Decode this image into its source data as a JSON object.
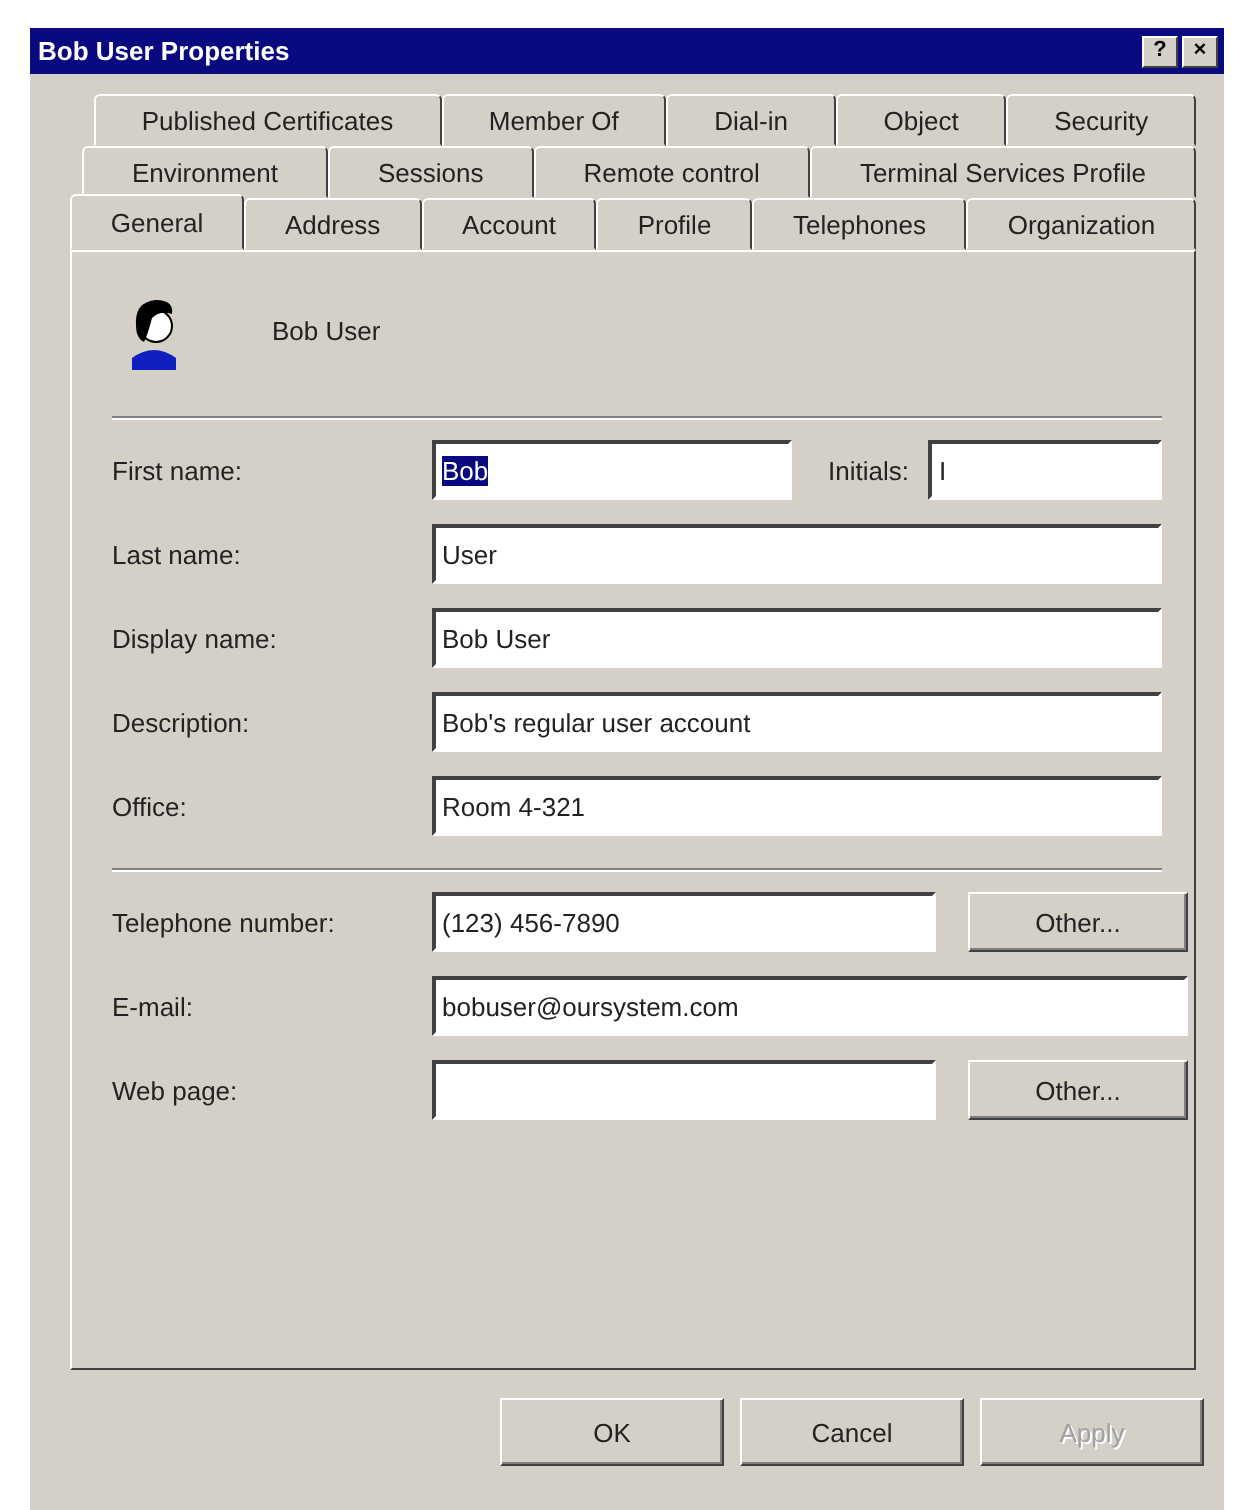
{
  "window": {
    "title": "Bob User Properties",
    "title_buttons": [
      "?",
      "×"
    ]
  },
  "tab_rows": [
    [
      {
        "label": "Published Certificates",
        "selected": false
      },
      {
        "label": "Member Of",
        "selected": false
      },
      {
        "label": "Dial-in",
        "selected": false
      },
      {
        "label": "Object",
        "selected": false
      },
      {
        "label": "Security",
        "selected": false
      }
    ],
    [
      {
        "label": "Environment",
        "selected": false
      },
      {
        "label": "Sessions",
        "selected": false
      },
      {
        "label": "Remote control",
        "selected": false
      },
      {
        "label": "Terminal Services Profile",
        "selected": false
      }
    ],
    [
      {
        "label": "General",
        "selected": true
      },
      {
        "label": "Address",
        "selected": false
      },
      {
        "label": "Account",
        "selected": false
      },
      {
        "label": "Profile",
        "selected": false
      },
      {
        "label": "Telephones",
        "selected": false
      },
      {
        "label": "Organization",
        "selected": false
      }
    ]
  ],
  "user": {
    "name": "Bob User"
  },
  "name_fields": [
    {
      "label": "First name:",
      "value": "Bob",
      "text_selected": true,
      "side_label": "Initials:",
      "side_value": "I"
    },
    {
      "label": "Last name:",
      "value": "User",
      "text_selected": false
    },
    {
      "label": "Display name:",
      "value": "Bob User",
      "text_selected": false
    },
    {
      "label": "Description:",
      "value": "Bob's regular user account",
      "text_selected": false
    },
    {
      "label": "Office:",
      "value": "Room 4-321",
      "text_selected": false
    }
  ],
  "contact_fields": [
    {
      "label": "Telephone number:",
      "value": "(123) 456-7890",
      "button": "Other..."
    },
    {
      "label": "E-mail:",
      "value": "bobuser@oursystem.com"
    },
    {
      "label": "Web page:",
      "button": "Other..."
    }
  ],
  "buttons": [
    {
      "label": "OK",
      "disabled": false
    },
    {
      "label": "Cancel",
      "disabled": false
    },
    {
      "label": "Apply",
      "disabled": true
    }
  ]
}
